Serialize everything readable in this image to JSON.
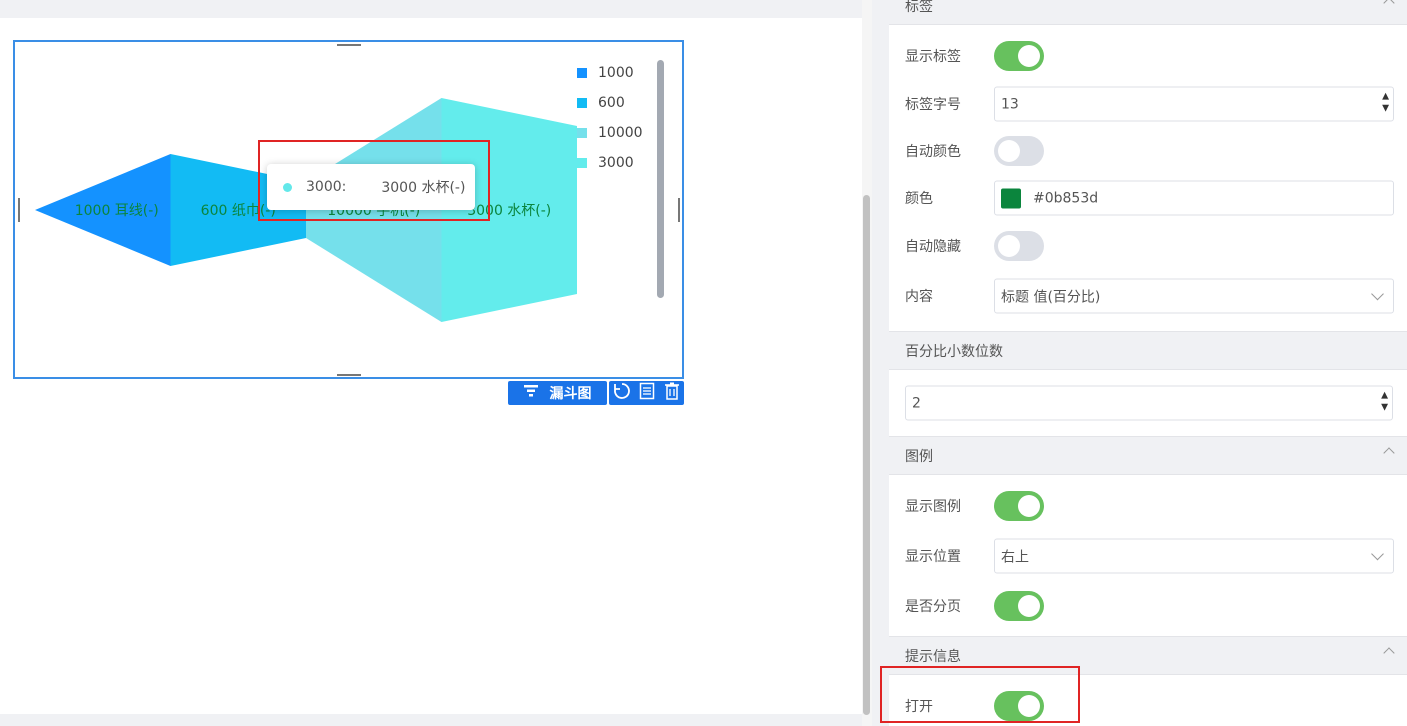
{
  "chart_data": {
    "type": "funnel",
    "sort": "ascending",
    "series": [
      {
        "name": "1000",
        "value": 1000,
        "label": "1000 耳线(-)",
        "color": "#1492ff"
      },
      {
        "name": "600",
        "value": 600,
        "label": "600 纸巾(-)",
        "color": "#12bbf4"
      },
      {
        "name": "10000",
        "value": 10000,
        "label": "10000 手机(-)",
        "color": "#75e0eb"
      },
      {
        "name": "3000",
        "value": 3000,
        "label": "3000 水杯(-)",
        "color": "#63ecec"
      }
    ],
    "legend": {
      "position": "top-right",
      "items": [
        "1000",
        "600",
        "10000",
        "3000"
      ]
    },
    "label_color": "#0b853d"
  },
  "tooltip": {
    "series_name": "3000:",
    "value_text": "3000 水杯(-)"
  },
  "toolbar": {
    "chart_type_label": "漏斗图"
  },
  "panel": {
    "label_section": {
      "title": "标签",
      "show_label": "显示标签",
      "font_size_label": "标签字号",
      "font_size_value": "13",
      "auto_color": "自动颜色",
      "color_label": "颜色",
      "color_value": "#0b853d",
      "auto_hide": "自动隐藏",
      "content_label": "内容",
      "content_value": "标题 值(百分比)"
    },
    "percent_section": {
      "title": "百分比小数位数",
      "value": "2"
    },
    "legend_section": {
      "title": "图例",
      "show_legend": "显示图例",
      "position_label": "显示位置",
      "position_value": "右上",
      "paging_label": "是否分页"
    },
    "tooltip_section": {
      "title": "提示信息",
      "open_label": "打开"
    }
  }
}
